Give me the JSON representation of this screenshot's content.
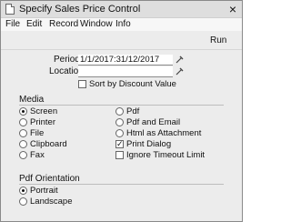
{
  "window": {
    "title": "Specify Sales Price Control",
    "close_glyph": "×"
  },
  "menu": [
    "File",
    "Edit",
    "Record",
    "Window",
    "Info"
  ],
  "toolbar": {
    "run_label": "Run"
  },
  "form": {
    "period_label": "Period",
    "period_value": "1/1/2017:31/12/2017",
    "location_label": "Location",
    "location_value": "",
    "sort_label": "Sort by Discount Value",
    "sort_checked": false
  },
  "media": {
    "title": "Media",
    "left": [
      {
        "label": "Screen",
        "selected": true
      },
      {
        "label": "Printer",
        "selected": false
      },
      {
        "label": "File",
        "selected": false
      },
      {
        "label": "Clipboard",
        "selected": false
      },
      {
        "label": "Fax",
        "selected": false
      }
    ],
    "right": [
      {
        "label": "Pdf",
        "selected": false
      },
      {
        "label": "Pdf and Email",
        "selected": false
      },
      {
        "label": "Html as Attachment",
        "selected": false
      }
    ],
    "print_dialog": {
      "label": "Print Dialog",
      "checked": true
    },
    "ignore_timeout": {
      "label": "Ignore Timeout Limit",
      "checked": false
    }
  },
  "orientation": {
    "title": "Pdf Orientation",
    "options": [
      {
        "label": "Portrait",
        "selected": true
      },
      {
        "label": "Landscape",
        "selected": false
      }
    ]
  }
}
